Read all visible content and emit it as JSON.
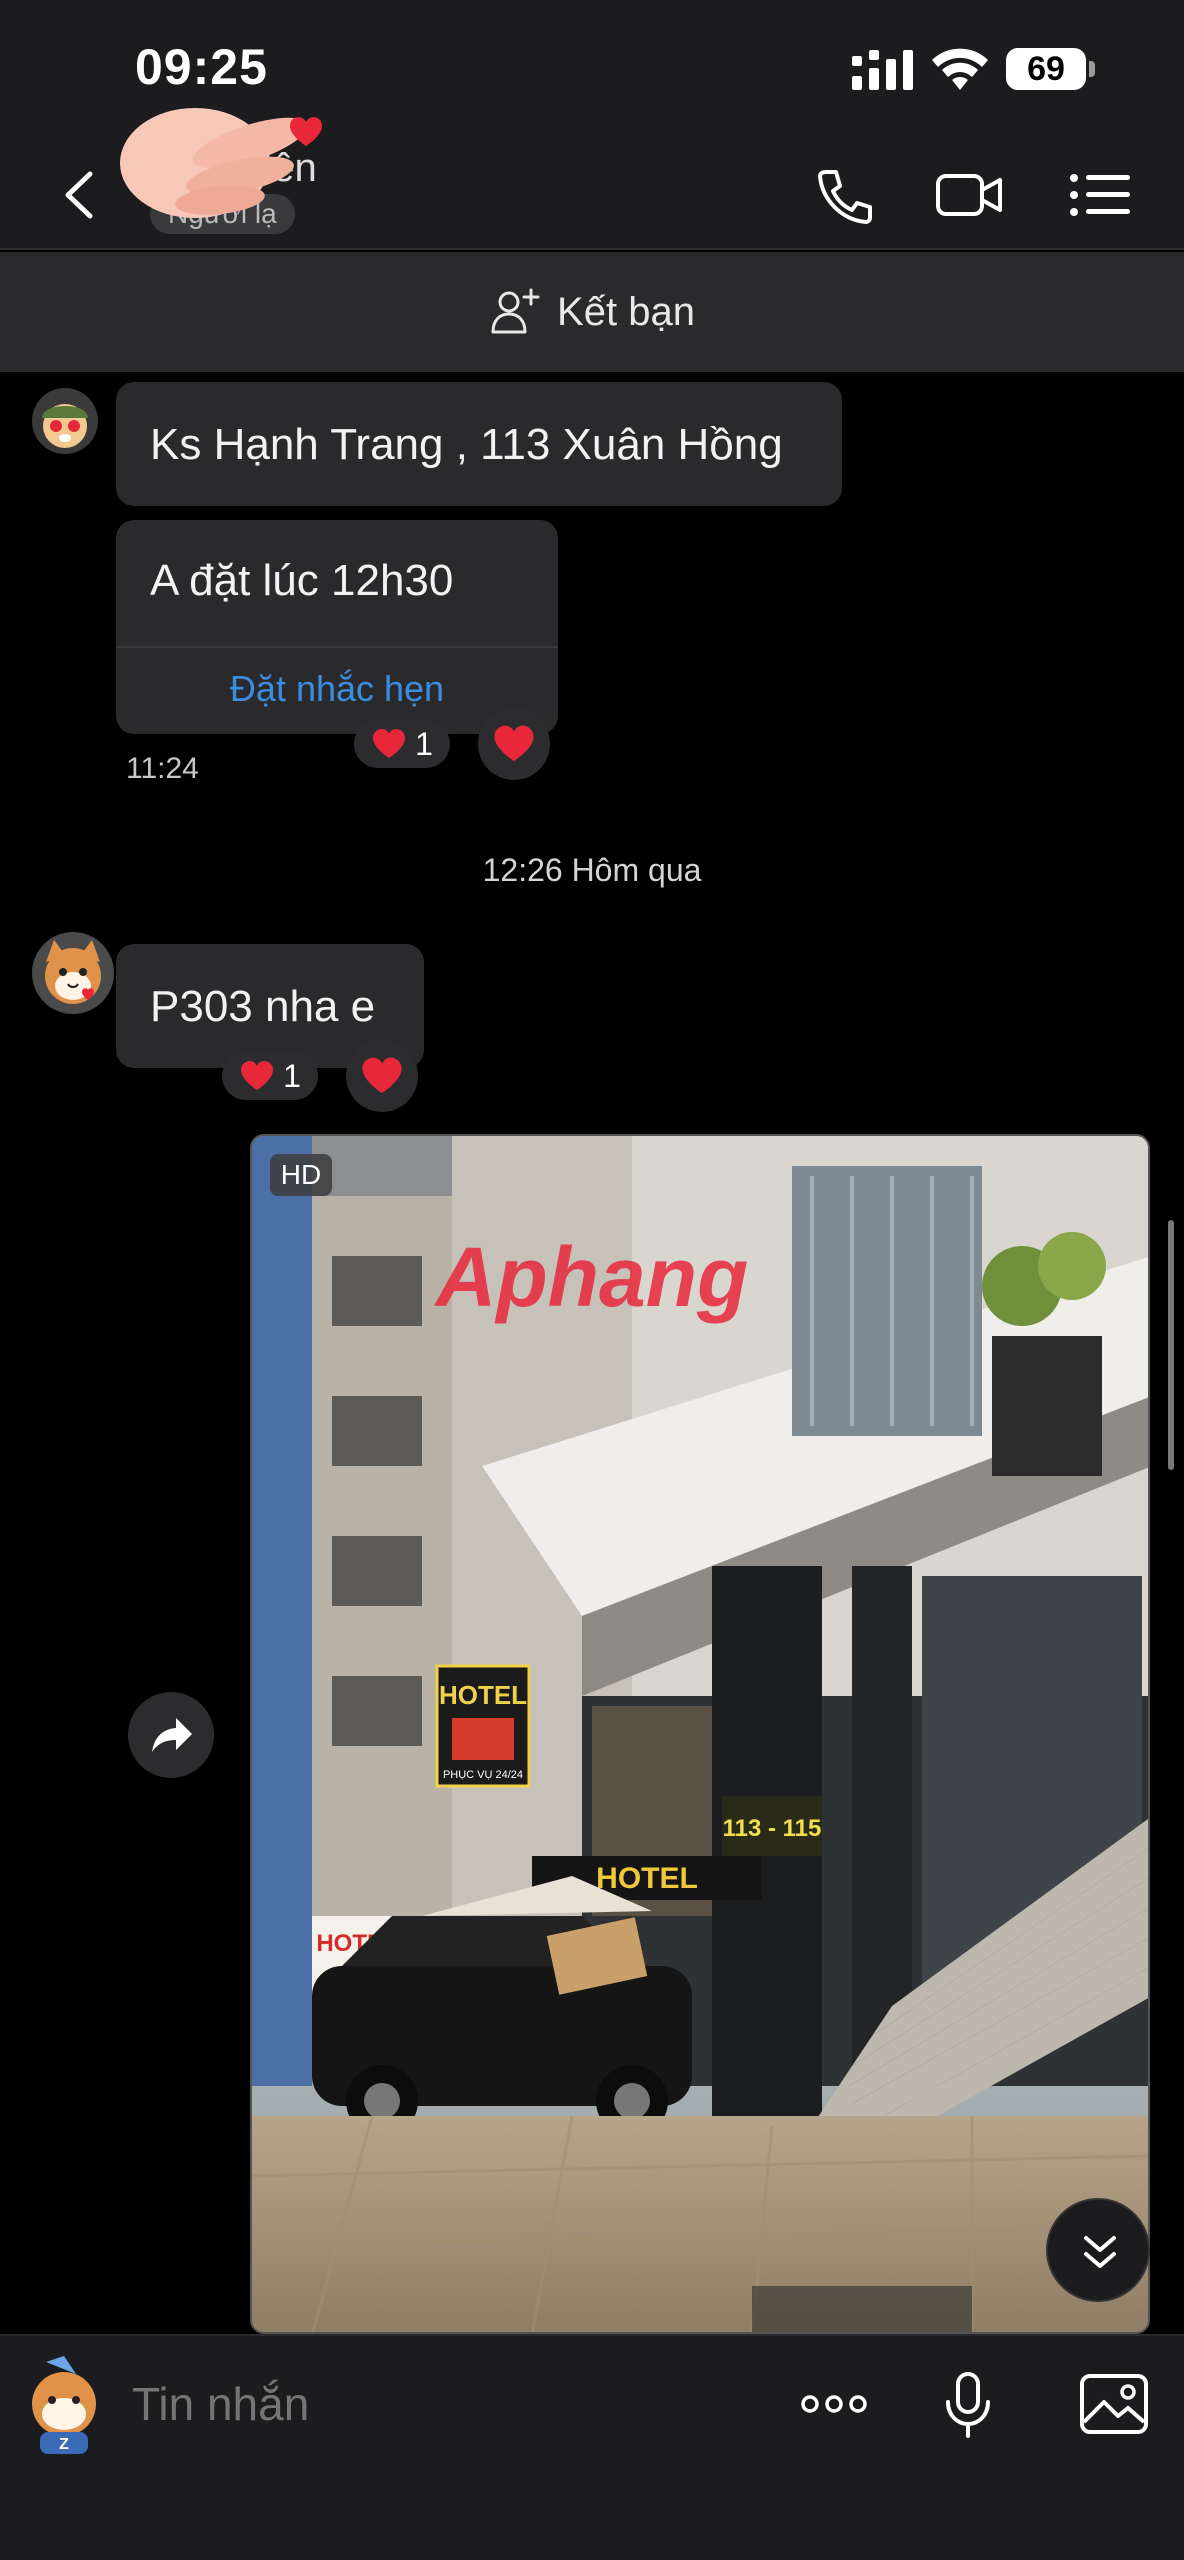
{
  "status": {
    "time": "09:25",
    "battery": "69"
  },
  "header": {
    "contact_name": "...iên",
    "contact_status": "Người lạ"
  },
  "add_friend": {
    "label": "Kết bạn"
  },
  "messages": [
    {
      "text": "Ks Hạnh Trang , 113 Xuân Hồng"
    },
    {
      "text": "A đặt lúc 12h30",
      "action": "Đặt nhắc hẹn",
      "reaction_count": "1",
      "time": "11:24"
    }
  ],
  "date_separator": "12:26 Hôm qua",
  "message3": {
    "text": "P303 nha e",
    "reaction_count": "1"
  },
  "photo": {
    "badge": "HD",
    "watermark": "Aphang",
    "signs": {
      "hotel1": "HOTEL",
      "hotel2": "HOTEL",
      "hotel3": "HOTEL",
      "addr": "113 - 115",
      "service": "PHỤC VỤ 24/24"
    }
  },
  "composer": {
    "placeholder": "Tin nhắn"
  },
  "colors": {
    "bubble": "#2a2a2c",
    "link": "#3a8de0",
    "heart": "#e8283a",
    "bar": "#1c1c1e"
  },
  "icons": [
    "back-icon",
    "phone-icon",
    "video-icon",
    "menu-icon",
    "add-person-icon",
    "heart-icon",
    "share-icon",
    "chevron-double-down-icon",
    "more-icon",
    "mic-icon",
    "image-icon",
    "sticker-icon"
  ]
}
